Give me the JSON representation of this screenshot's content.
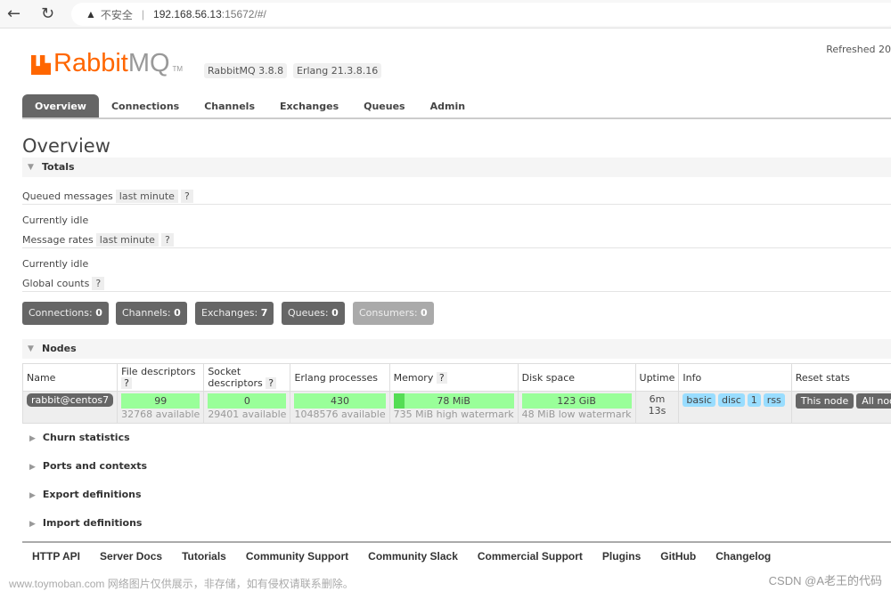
{
  "browser": {
    "security": "不安全",
    "url_host": "192.168.56.13",
    "url_rest": ":15672/#/"
  },
  "header": {
    "logo_rabbit": "Rabbit",
    "logo_mq": "MQ",
    "logo_tm": "TM",
    "version": "RabbitMQ 3.8.8",
    "erlang": "Erlang 21.3.8.16",
    "refreshed": "Refreshed 20"
  },
  "tabs": [
    "Overview",
    "Connections",
    "Channels",
    "Exchanges",
    "Queues",
    "Admin"
  ],
  "page_title": "Overview",
  "totals": {
    "title": "Totals",
    "queued_label": "Queued messages",
    "queued_range": "last minute",
    "help": "?",
    "idle1": "Currently idle",
    "rates_label": "Message rates",
    "rates_range": "last minute",
    "idle2": "Currently idle",
    "global_label": "Global counts"
  },
  "counts": [
    {
      "label": "Connections:",
      "value": "0"
    },
    {
      "label": "Channels:",
      "value": "0"
    },
    {
      "label": "Exchanges:",
      "value": "7"
    },
    {
      "label": "Queues:",
      "value": "0"
    },
    {
      "label": "Consumers:",
      "value": "0"
    }
  ],
  "nodes": {
    "title": "Nodes",
    "headers": [
      "Name",
      "File descriptors",
      "Socket descriptors",
      "Erlang processes",
      "Memory",
      "Disk space",
      "Uptime",
      "Info",
      "Reset stats"
    ],
    "row": {
      "name": "rabbit@centos7",
      "fd": "99",
      "fd_sub": "32768 available",
      "sd": "0",
      "sd_sub": "29401 available",
      "ep": "430",
      "ep_sub": "1048576 available",
      "mem": "78 MiB",
      "mem_sub": "735 MiB high watermark",
      "disk": "123 GiB",
      "disk_sub": "48 MiB low watermark",
      "uptime": "6m 13s",
      "info": [
        "basic",
        "disc",
        "1",
        "rss"
      ],
      "reset": [
        "This node",
        "All nodes"
      ]
    }
  },
  "collapsed": [
    "Churn statistics",
    "Ports and contexts",
    "Export definitions",
    "Import definitions"
  ],
  "footer": [
    "HTTP API",
    "Server Docs",
    "Tutorials",
    "Community Support",
    "Community Slack",
    "Commercial Support",
    "Plugins",
    "GitHub",
    "Changelog"
  ],
  "watermark": "www.toymoban.com 网络图片仅供展示，非存储，如有侵权请联系删除。",
  "csdn": "CSDN @A老王的代码",
  "colors": {
    "brand": "#ff6600",
    "bar_green": "#99ff99",
    "info_blue": "#99ddff"
  }
}
